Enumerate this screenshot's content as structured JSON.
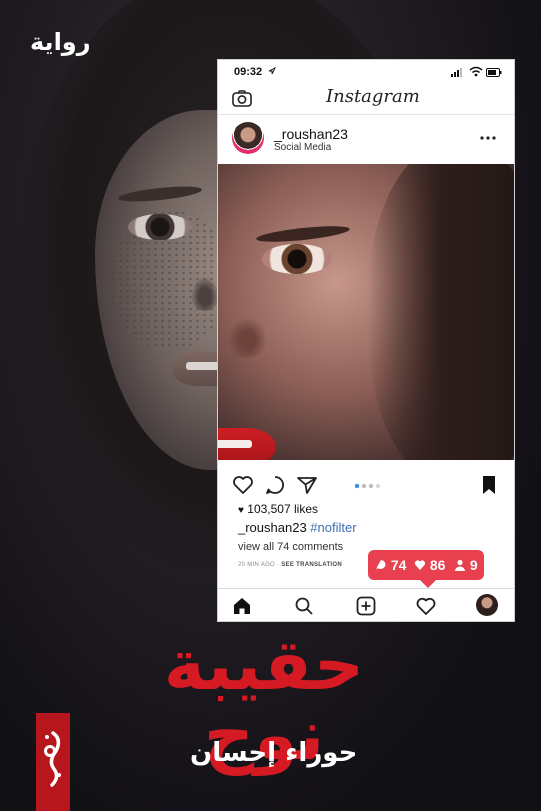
{
  "cover": {
    "tag": "رواية",
    "title": "حقيبة نوح",
    "author": "حوراء إحسان",
    "colors": {
      "title": "#d51a24",
      "background": "#141318",
      "publisher_badge": "#b8161d"
    }
  },
  "phone": {
    "status": {
      "time": "09:32"
    },
    "header": {
      "logo": "Instagram"
    },
    "post": {
      "username": "_roushan23",
      "subtitle": "Social Media",
      "likes": "103,507 likes",
      "caption_user": "_roushan23",
      "caption_tag": "#nofilter",
      "comments": "view all 74 comments",
      "time_ago": "20 MIN AGO",
      "translate": "SEE TRANSLATION"
    },
    "notification": {
      "comments": "74",
      "likes": "86",
      "follows": "9",
      "accent": "#e8404f"
    },
    "icons": [
      "camera-icon",
      "more-icon",
      "heart-icon",
      "comment-icon",
      "share-icon",
      "bookmark-icon",
      "home-icon",
      "search-icon",
      "add-icon",
      "activity-icon"
    ]
  }
}
